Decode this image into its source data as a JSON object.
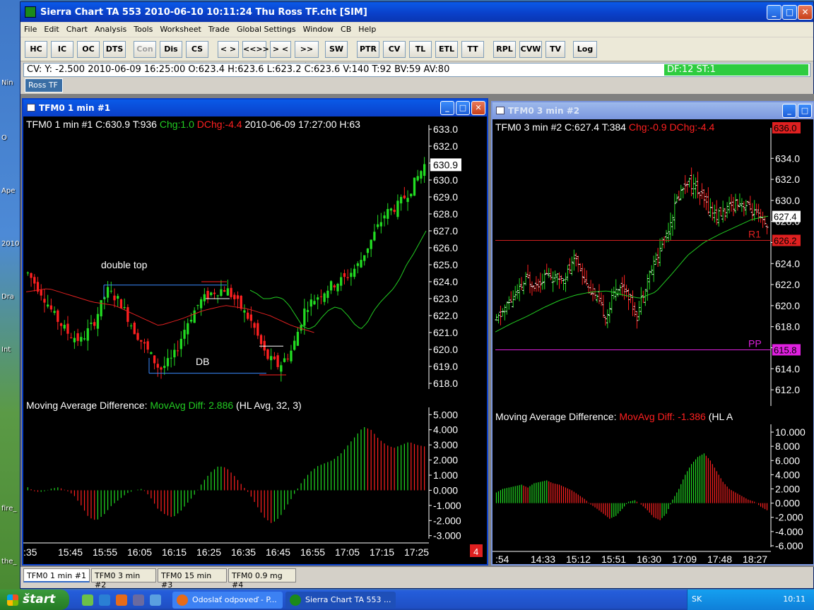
{
  "window": {
    "title": "Sierra Chart TA 553  2010-06-10  10:11:24  Thu   Ross TF.cht [SIM]"
  },
  "menu": [
    "File",
    "Edit",
    "Chart",
    "Analysis",
    "Tools",
    "Worksheet",
    "Trade",
    "Global Settings",
    "Window",
    "CB",
    "Help"
  ],
  "toolbar": [
    {
      "label": "HC",
      "enabled": true
    },
    {
      "label": "IC",
      "enabled": true
    },
    {
      "label": "OC",
      "enabled": true
    },
    {
      "label": "DTS",
      "enabled": true
    },
    {
      "label": "Con",
      "enabled": false
    },
    {
      "label": "Dis",
      "enabled": true
    },
    {
      "label": "CS",
      "enabled": true
    },
    {
      "label": "< >",
      "enabled": true
    },
    {
      "label": "<<>>",
      "enabled": true
    },
    {
      "label": "> <",
      "enabled": true
    },
    {
      "label": ">><<",
      "enabled": true
    },
    {
      "label": "SW",
      "enabled": true
    },
    {
      "label": "PTR",
      "enabled": true
    },
    {
      "label": "CV",
      "enabled": true
    },
    {
      "label": "TL",
      "enabled": true
    },
    {
      "label": "ETL",
      "enabled": true
    },
    {
      "label": "TT",
      "enabled": true
    },
    {
      "label": "RPL",
      "enabled": true
    },
    {
      "label": "CVW",
      "enabled": true
    },
    {
      "label": "TV",
      "enabled": true
    },
    {
      "label": "Log",
      "enabled": true
    }
  ],
  "cv_bar": {
    "text": "CV: Y: -2.500  2010-06-09  16:25:00  O:623.4  H:623.6  L:623.2  C:623.6  V:140  T:92  BV:59  AV:80",
    "status": "DF:12  ST:1"
  },
  "chartbook_tab": "Ross TF",
  "chart1": {
    "window_title": "TFM0  1 min   #1",
    "header": {
      "main": "TFM0  1 min   #1  C:630.9  T:936",
      "chg": "Chg:1.0",
      "dchg": "DChg:-4.4",
      "date": "2010-06-09   17:27:00  H:63"
    },
    "last_price": "630.9",
    "indicator_label": "Moving Average Difference:",
    "indicator_value": "MovAvg Diff: 2.886",
    "indicator_params": "(HL Avg, 32, 3)",
    "annotations": {
      "double_top": "double top",
      "db": "DB"
    },
    "page_badge": "4"
  },
  "chart2": {
    "window_title": "TFM0  3 min   #2",
    "header": {
      "main": "TFM0  3 min   #2  C:627.4  T:384",
      "chg": "Chg:-0.9",
      "dchg": "DChg:-4.4",
      "hi": "636.0"
    },
    "last_price": "627.4",
    "r1_label": "R1",
    "r1_value": "626.2",
    "pp_label": "PP",
    "pp_value": "615.8",
    "indicator_label": "Moving Average Difference:",
    "indicator_value": "MovAvg Diff: -1.386",
    "indicator_params": "(HL A"
  },
  "chart_data": [
    {
      "type": "candlestick",
      "title": "TFM0  1 min   #1",
      "x_ticks": [
        ":35",
        "15:45",
        "15:55",
        "16:05",
        "16:15",
        "16:25",
        "16:35",
        "16:45",
        "16:55",
        "17:05",
        "17:15",
        "17:25"
      ],
      "y_ticks": [
        "633.0",
        "632.0",
        "631.0",
        "630.0",
        "629.0",
        "628.0",
        "627.0",
        "626.0",
        "625.0",
        "624.0",
        "623.0",
        "622.0",
        "621.0",
        "620.0",
        "619.0",
        "618.0"
      ],
      "ylim": [
        618,
        633
      ],
      "close_path": [
        624.5,
        623.4,
        622.0,
        621.0,
        620.5,
        621.6,
        623.5,
        622.8,
        621.2,
        620.0,
        618.8,
        619.5,
        621.5,
        622.8,
        623.4,
        623.6,
        622.6,
        621.5,
        619.6,
        619.0,
        620.0,
        622.5,
        623.2,
        623.8,
        624.2,
        625.0,
        626.5,
        628.0,
        628.5,
        629.5,
        630.9
      ],
      "ma_path": [
        623.5,
        623.3,
        623.0,
        623.0,
        623.1,
        623.0,
        622.6,
        622.0,
        621.4,
        621.2,
        621.4,
        621.9,
        622.3,
        622.5,
        622.4,
        622.0,
        621.5,
        621.2,
        621.6,
        622.3,
        622.8,
        623.2,
        623.6,
        624.2,
        625.0,
        625.6,
        626.3,
        627.0
      ]
    },
    {
      "type": "bar",
      "title": "Moving Average Difference",
      "y_ticks": [
        "5.000",
        "4.000",
        "3.000",
        "2.000",
        "1.000",
        "0.000",
        "-1.000",
        "-2.000",
        "-3.000"
      ],
      "ylim": [
        -3.2,
        5.2
      ],
      "values": [
        0.2,
        -0.1,
        -0.1,
        0.1,
        0.2,
        0,
        -0.3,
        -1.0,
        -1.8,
        -2.0,
        -1.6,
        -1.0,
        -0.6,
        -0.2,
        0,
        0.1,
        -0.4,
        -1.2,
        -1.6,
        -1.8,
        -1.4,
        -0.8,
        -0.2,
        0.6,
        1.2,
        1.6,
        1.5,
        1.0,
        0.4,
        -0.2,
        -1.0,
        -1.8,
        -2.2,
        -1.8,
        -1.0,
        -0.2,
        0.6,
        1.2,
        1.6,
        1.8,
        2.0,
        2.4,
        3.0,
        3.6,
        4.2,
        4.0,
        3.4,
        3.0,
        2.8,
        3.0,
        3.2,
        3.0,
        2.9
      ]
    },
    {
      "type": "candlestick",
      "title": "TFM0  3 min   #2",
      "x_ticks": [
        ":54",
        "14:33",
        "15:12",
        "15:51",
        "16:30",
        "17:09",
        "17:48",
        "18:27"
      ],
      "y_ticks": [
        "634.0",
        "632.0",
        "630.0",
        "628.0",
        "626.0",
        "624.0",
        "622.0",
        "620.0",
        "618.0",
        "616.0",
        "614.0",
        "612.0"
      ],
      "ylim": [
        611,
        636.5
      ],
      "close_path": [
        618.5,
        620.0,
        621.0,
        622.5,
        622.0,
        623.0,
        622.5,
        623.0,
        624.5,
        622.0,
        620.5,
        619.0,
        622.0,
        621.5,
        619.0,
        622.5,
        624.5,
        627.0,
        630.0,
        632.0,
        631.0,
        629.5,
        628.5,
        629.0,
        630.0,
        629.5,
        628.5,
        627.4
      ],
      "ma_path": [
        617.5,
        618.3,
        619.0,
        619.8,
        620.5,
        621.0,
        621.3,
        621.4,
        621.0,
        620.7,
        621.3,
        623.0,
        624.8,
        626.0,
        626.8,
        627.5,
        628.2,
        628.5
      ]
    },
    {
      "type": "bar",
      "title": "Moving Average Difference",
      "y_ticks": [
        "10.000",
        "8.000",
        "6.000",
        "4.000",
        "2.000",
        "0.000",
        "-2.000",
        "-4.000",
        "-6.000"
      ],
      "ylim": [
        -6.2,
        10.5
      ],
      "values": [
        1.5,
        2.0,
        2.2,
        2.4,
        2.6,
        2.2,
        2.8,
        3.0,
        3.2,
        2.8,
        2.6,
        2.2,
        1.8,
        1.2,
        0.6,
        -0.2,
        -0.8,
        -1.5,
        -2.2,
        -1.8,
        -0.8,
        0.2,
        0.4,
        -0.2,
        -1.0,
        -2.0,
        -2.4,
        -1.5,
        0.5,
        2.0,
        4.0,
        5.5,
        6.5,
        7.0,
        6.0,
        4.5,
        3.0,
        2.0,
        1.5,
        1.0,
        0.5,
        0.2,
        -0.5,
        -1.0
      ]
    }
  ]
}
